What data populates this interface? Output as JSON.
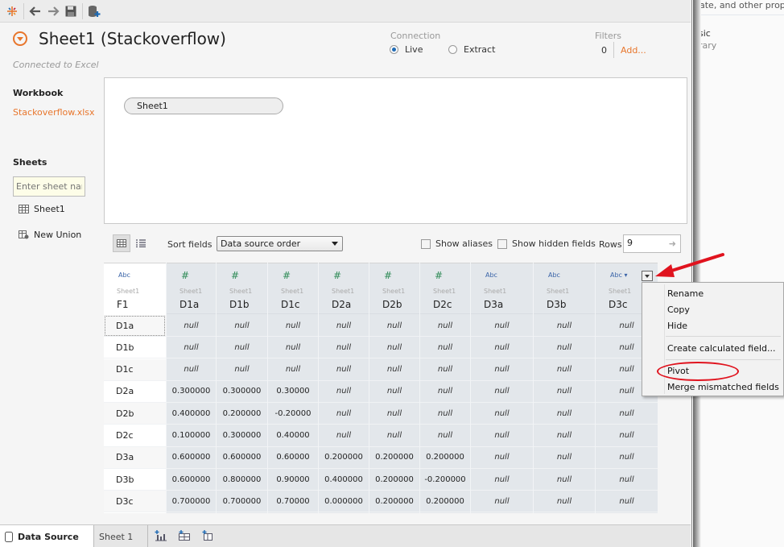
{
  "toolbar": {
    "icons": [
      "tableau-logo-icon",
      "back-arrow-icon",
      "forward-arrow-icon",
      "save-icon",
      "new-data-source-icon"
    ]
  },
  "header": {
    "title": "Sheet1 (Stackoverflow)",
    "subtitle": "Connected to Excel",
    "connection_label": "Connection",
    "connection_options": [
      {
        "label": "Live",
        "selected": true
      },
      {
        "label": "Extract",
        "selected": false
      }
    ],
    "filters_label": "Filters",
    "filters_count": "0",
    "filters_add": "Add..."
  },
  "sidebar": {
    "workbook_heading": "Workbook",
    "workbook_file": "Stackoverflow.xlsx",
    "sheets_heading": "Sheets",
    "sheet_search_placeholder": "Enter sheet name",
    "items": [
      {
        "label": "Sheet1",
        "icon": "table-icon"
      },
      {
        "label": "New Union",
        "icon": "union-icon"
      }
    ]
  },
  "canvas": {
    "tables": [
      {
        "label": "Sheet1"
      }
    ]
  },
  "grid_toolbar": {
    "sort_label": "Sort fields",
    "sort_value": "Data source order",
    "show_aliases": "Show aliases",
    "show_hidden": "Show hidden fields",
    "rows_label": "Rows",
    "rows_value": "9"
  },
  "grid": {
    "columns": [
      {
        "type": "Abc",
        "source": "Sheet1",
        "name": "F1"
      },
      {
        "type": "#",
        "source": "Sheet1",
        "name": "D1a"
      },
      {
        "type": "#",
        "source": "Sheet1",
        "name": "D1b"
      },
      {
        "type": "#",
        "source": "Sheet1",
        "name": "D1c"
      },
      {
        "type": "#",
        "source": "Sheet1",
        "name": "D2a"
      },
      {
        "type": "#",
        "source": "Sheet1",
        "name": "D2b"
      },
      {
        "type": "#",
        "source": "Sheet1",
        "name": "D2c"
      },
      {
        "type": "Abc",
        "source": "Sheet1",
        "name": "D3a"
      },
      {
        "type": "Abc",
        "source": "Sheet1",
        "name": "D3b"
      },
      {
        "type": "Abc ▾",
        "source": "Sheet1",
        "name": "D3c"
      }
    ],
    "rows": [
      [
        "D1a",
        "null",
        "null",
        "null",
        "null",
        "null",
        "null",
        "null",
        "null",
        "null"
      ],
      [
        "D1b",
        "null",
        "null",
        "null",
        "null",
        "null",
        "null",
        "null",
        "null",
        "null"
      ],
      [
        "D1c",
        "null",
        "null",
        "null",
        "null",
        "null",
        "null",
        "null",
        "null",
        "null"
      ],
      [
        "D2a",
        "0.300000",
        "0.300000",
        "0.30000",
        "null",
        "null",
        "null",
        "null",
        "null",
        "null"
      ],
      [
        "D2b",
        "0.400000",
        "0.200000",
        "-0.20000",
        "null",
        "null",
        "null",
        "null",
        "null",
        "null"
      ],
      [
        "D2c",
        "0.100000",
        "0.300000",
        "0.40000",
        "null",
        "null",
        "null",
        "null",
        "null",
        "null"
      ],
      [
        "D3a",
        "0.600000",
        "0.600000",
        "0.60000",
        "0.200000",
        "0.200000",
        "0.200000",
        "null",
        "null",
        "null"
      ],
      [
        "D3b",
        "0.600000",
        "0.800000",
        "0.90000",
        "0.400000",
        "0.200000",
        "-0.200000",
        "null",
        "null",
        "null"
      ],
      [
        "D3c",
        "0.700000",
        "0.700000",
        "0.70000",
        "0.000000",
        "0.200000",
        "0.200000",
        "null",
        "null",
        "null"
      ]
    ]
  },
  "context_menu": {
    "items": [
      "Rename",
      "Copy",
      "Hide",
      "Create calculated field...",
      "Pivot",
      "Merge mismatched fields"
    ],
    "highlighted": "Pivot"
  },
  "annotation": {
    "color": "#e0131e"
  },
  "bottom_tabs": {
    "data_source": "Data Source",
    "sheet": "Sheet 1",
    "icons": [
      "new-worksheet-icon",
      "new-dashboard-icon",
      "new-story-icon"
    ]
  },
  "background_window": {
    "line1": "ate, and other propertie",
    "line2": "usic",
    "line3": "brary"
  },
  "colors": {
    "accent": "#e8762c",
    "abc_type": "#3a64a8",
    "number_type": "#2d8a55",
    "measure_bg": "#e3e7eb"
  }
}
